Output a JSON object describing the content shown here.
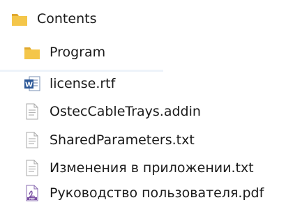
{
  "tree": {
    "root": {
      "label": "Contents",
      "icon": "folder-icon"
    },
    "items": [
      {
        "label": "Program",
        "icon": "folder-icon",
        "type": "folder"
      },
      {
        "label": "license.rtf",
        "icon": "word-document-icon",
        "type": "file"
      },
      {
        "label": "OstecCableTrays.addin",
        "icon": "text-file-icon",
        "type": "file"
      },
      {
        "label": "SharedParameters.txt",
        "icon": "text-file-icon",
        "type": "file"
      },
      {
        "label": "Изменения в приложении.txt",
        "icon": "text-file-icon",
        "type": "file"
      },
      {
        "label": "Руководство пользователя.pdf",
        "icon": "pdf-file-icon",
        "type": "file"
      }
    ]
  },
  "colors": {
    "folder": "#f4c64a",
    "folder_dark": "#e0a82e",
    "word_blue": "#2b5797",
    "text_file_gray": "#9a9a9a",
    "pdf_purple": "#7a4fa3"
  }
}
